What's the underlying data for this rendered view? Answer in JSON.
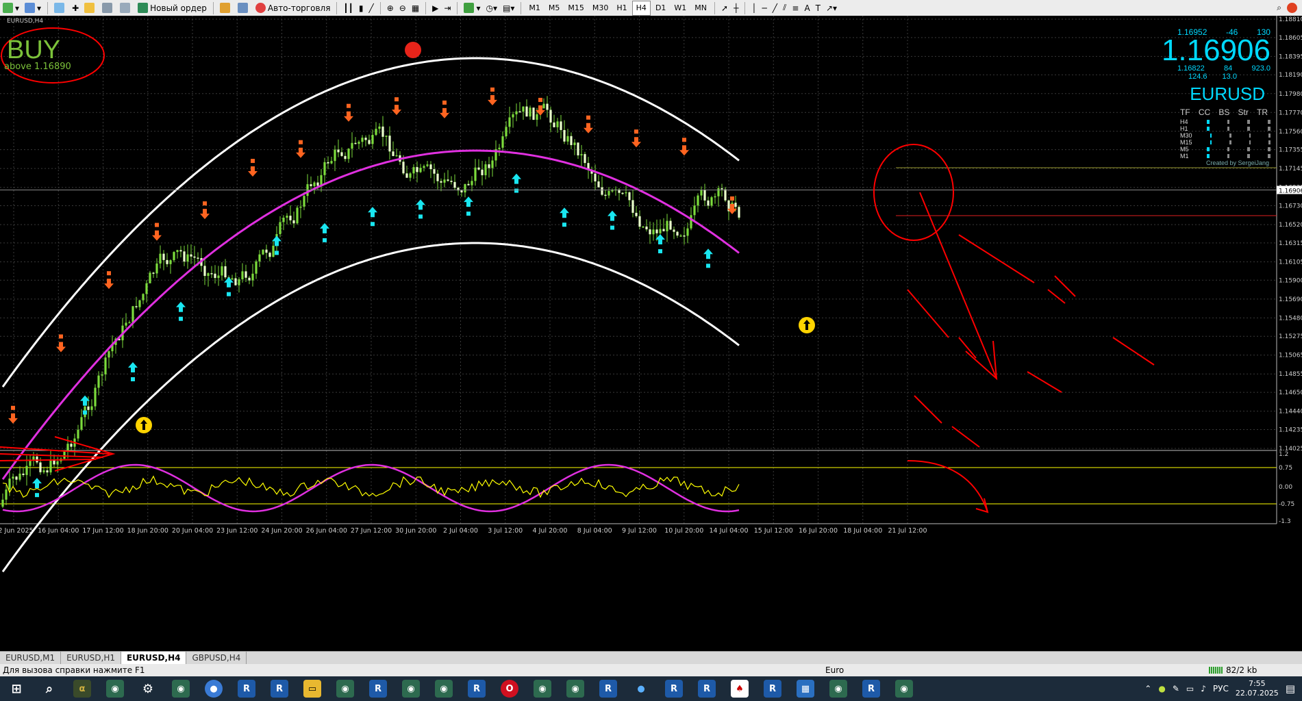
{
  "toolbar": {
    "new_order_label": "Новый ордер",
    "auto_trading_label": "Авто-торговля",
    "timeframes": [
      "M1",
      "M5",
      "M15",
      "M30",
      "H1",
      "H4",
      "D1",
      "W1",
      "MN"
    ]
  },
  "chart": {
    "symbol_label": "EURUSD,H4",
    "signal": "BUY",
    "signal_sub": "above 1.16890",
    "price_levels": [
      "1.18810",
      "1.18605",
      "1.18395",
      "1.18190",
      "1.17980",
      "1.17770",
      "1.17560",
      "1.17355",
      "1.17145",
      "1.16935",
      "1.16730",
      "1.16520",
      "1.16315",
      "1.16105",
      "1.15900",
      "1.15690",
      "1.15480",
      "1.15275",
      "1.15065",
      "1.14855",
      "1.14650",
      "1.14440",
      "1.14235",
      "1.14025"
    ],
    "current_price": "1.16906",
    "red_level_price": "1.16620",
    "time_labels": [
      "12 Jun 2025",
      "16 Jun 04:00",
      "17 Jun 12:00",
      "18 Jun 20:00",
      "20 Jun 04:00",
      "23 Jun 12:00",
      "24 Jun 20:00",
      "26 Jun 04:00",
      "27 Jun 12:00",
      "30 Jun 20:00",
      "2 Jul 04:00",
      "3 Jul 12:00",
      "4 Jul 20:00",
      "8 Jul 04:00",
      "9 Jul 12:00",
      "10 Jul 20:00",
      "14 Jul 04:00",
      "15 Jul 12:00",
      "16 Jul 20:00",
      "18 Jul 04:00",
      "21 Jul 12:00"
    ],
    "osc_levels": [
      "1.2",
      "0.75",
      "0.00",
      "-0.75",
      "-1.3"
    ]
  },
  "panel": {
    "top_line": [
      "1.16952",
      "-46",
      "130"
    ],
    "big_price": "1.16906",
    "second_line": [
      "1.16822",
      "84",
      "923.0"
    ],
    "third_line": [
      "124.6",
      "13.0"
    ],
    "symbol": "EURUSD",
    "table_headers": [
      "TF",
      "CC",
      "BS",
      "Str",
      "TR"
    ],
    "rows": [
      "H4",
      "H1",
      "M30",
      "M15",
      "M5",
      "M1"
    ],
    "created_by": "Created by SergeiJang"
  },
  "tabs": [
    "EURUSD,M1",
    "EURUSD,H1",
    "EURUSD,H4",
    "GBPUSD,H4"
  ],
  "status": {
    "help_text": "Для вызова справки нажмите F1",
    "profile": "Euro",
    "traffic": "82/2 kb"
  },
  "taskbar": {
    "lang": "РУС",
    "time": "7:55",
    "date": "22.07.2025"
  },
  "colors": {
    "band": "#ffffff",
    "midline": "#e030e0",
    "candle": "#7cdb3c",
    "arrow_up": "#19e6f0",
    "arrow_down": "#ff6420",
    "panel": "#00d9ff",
    "annotation": "#ff0000",
    "osc_yellow": "#ffff00"
  }
}
